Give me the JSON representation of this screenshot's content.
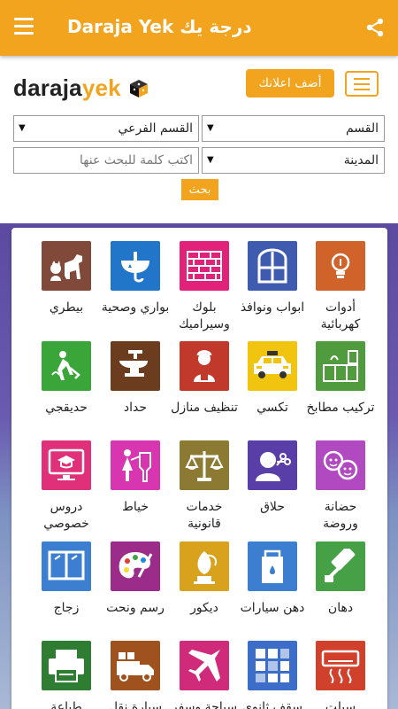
{
  "appbar": {
    "title": "Daraja Yek درجة يك",
    "menu_icon": "menu-icon",
    "share_icon": "share-icon",
    "color": "#f3a41f"
  },
  "header": {
    "logo_part1": "daraja",
    "logo_part2": "yek",
    "add_ad_label": "أضف اعلانك"
  },
  "filters": {
    "category": "القسم",
    "subcategory": "القسم الفرعي",
    "city": "المدينة",
    "search_placeholder": "اكتب كلمة للبحث عنها",
    "search_button": "بحث"
  },
  "categories": [
    {
      "label": "أدوات كهربائية",
      "icon": "lightbulb-icon",
      "color": "#d0632a"
    },
    {
      "label": "ابواب ونوافذ",
      "icon": "window-icon",
      "color": "#3f5bb0"
    },
    {
      "label": "بلوك وسيراميك",
      "icon": "brick-wall-icon",
      "color": "#e2217a"
    },
    {
      "label": "بواري وصحية",
      "icon": "sink-icon",
      "color": "#2276c9"
    },
    {
      "label": "بيطري",
      "icon": "animals-icon",
      "color": "#80493a"
    },
    {
      "label": "تركيب مطابخ",
      "icon": "kitchen-icon",
      "color": "#4f9b3e"
    },
    {
      "label": "تكسي",
      "icon": "taxi-icon",
      "color": "#f1c40f"
    },
    {
      "label": "تنظيف منازل",
      "icon": "cleaner-icon",
      "color": "#c0392b"
    },
    {
      "label": "حداد",
      "icon": "anvil-icon",
      "color": "#6b3d1e"
    },
    {
      "label": "حديقجي",
      "icon": "gardener-icon",
      "color": "#3aa63a"
    },
    {
      "label": "حضانة وروضة",
      "icon": "children-icon",
      "color": "#b14ac0"
    },
    {
      "label": "حلاق",
      "icon": "barber-icon",
      "color": "#5a3ea8"
    },
    {
      "label": "خدمات قانونية",
      "icon": "scales-icon",
      "color": "#8c7a32"
    },
    {
      "label": "خياط",
      "icon": "tailor-icon",
      "color": "#d835b0"
    },
    {
      "label": "دروس خصوصي",
      "icon": "tutoring-icon",
      "color": "#e0307a"
    },
    {
      "label": "دهان",
      "icon": "paint-roller-icon",
      "color": "#45a046"
    },
    {
      "label": "دهن سيارات",
      "icon": "paint-can-icon",
      "color": "#3c7fd0"
    },
    {
      "label": "ديكور",
      "icon": "decor-icon",
      "color": "#d8a21c"
    },
    {
      "label": "رسم ونحت",
      "icon": "palette-icon",
      "color": "#9b2c8a"
    },
    {
      "label": "زجاج",
      "icon": "glass-window-icon",
      "color": "#3c7fd0"
    },
    {
      "label": "سبلت",
      "icon": "air-conditioner-icon",
      "color": "#d0402a"
    },
    {
      "label": "سقف ثانوي",
      "icon": "ceiling-icon",
      "color": "#3c6ec9"
    },
    {
      "label": "سياحة وسفر",
      "icon": "airplane-icon",
      "color": "#d02a7a"
    },
    {
      "label": "سيارة نقل",
      "icon": "truck-icon",
      "color": "#a0521e"
    },
    {
      "label": "طباعة",
      "icon": "printer-icon",
      "color": "#2e7d32"
    }
  ]
}
